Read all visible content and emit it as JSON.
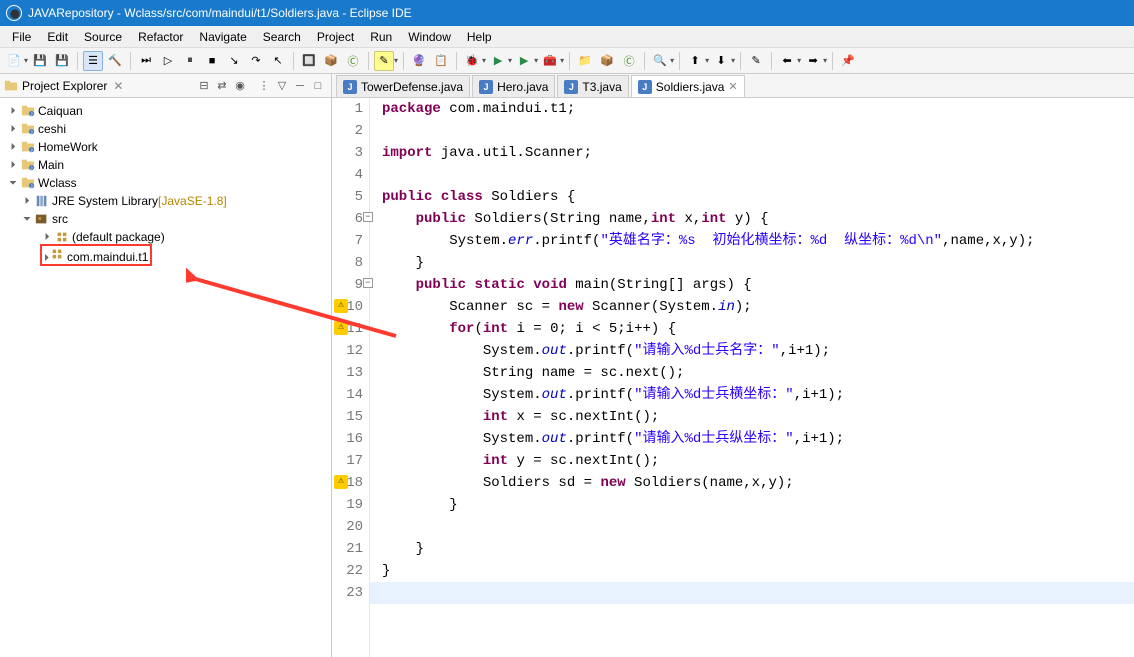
{
  "window": {
    "title": "JAVARepository - Wclass/src/com/maindui/t1/Soldiers.java - Eclipse IDE"
  },
  "menu": [
    "File",
    "Edit",
    "Source",
    "Refactor",
    "Navigate",
    "Search",
    "Project",
    "Run",
    "Window",
    "Help"
  ],
  "explorer": {
    "title": "Project Explorer",
    "projects": [
      {
        "name": "Caiquan",
        "expanded": false
      },
      {
        "name": "ceshi",
        "expanded": false
      },
      {
        "name": "HomeWork",
        "expanded": false
      },
      {
        "name": "Main",
        "expanded": false
      },
      {
        "name": "Wclass",
        "expanded": true,
        "children": [
          {
            "name": "JRE System Library",
            "hint": "[JavaSE-1.8]",
            "type": "lib",
            "expanded": false
          },
          {
            "name": "src",
            "type": "src",
            "expanded": true,
            "children": [
              {
                "name": "(default package)",
                "type": "pkg",
                "expanded": false
              },
              {
                "name": "com.maindui.t1",
                "type": "pkg",
                "expanded": false,
                "highlighted": true
              }
            ]
          }
        ]
      }
    ]
  },
  "tabs": [
    {
      "label": "TowerDefense.java",
      "active": false
    },
    {
      "label": "Hero.java",
      "active": false
    },
    {
      "label": "T3.java",
      "active": false
    },
    {
      "label": "Soldiers.java",
      "active": true
    }
  ],
  "code_lines": [
    {
      "n": 1,
      "tokens": [
        [
          "kw",
          "package"
        ],
        [
          "",
          " com.maindui.t1;"
        ]
      ]
    },
    {
      "n": 2,
      "tokens": []
    },
    {
      "n": 3,
      "tokens": [
        [
          "kw",
          "import"
        ],
        [
          "",
          " java.util.Scanner;"
        ]
      ]
    },
    {
      "n": 4,
      "tokens": []
    },
    {
      "n": 5,
      "tokens": [
        [
          "kw",
          "public"
        ],
        [
          "",
          " "
        ],
        [
          "kw",
          "class"
        ],
        [
          "",
          " Soldiers {"
        ]
      ]
    },
    {
      "n": 6,
      "fold": true,
      "tokens": [
        [
          "",
          "    "
        ],
        [
          "kw",
          "public"
        ],
        [
          "",
          " Soldiers(String name,"
        ],
        [
          "kw",
          "int"
        ],
        [
          "",
          " x,"
        ],
        [
          "kw",
          "int"
        ],
        [
          "",
          " y) {"
        ]
      ]
    },
    {
      "n": 7,
      "tokens": [
        [
          "",
          "        System."
        ],
        [
          "field",
          "err"
        ],
        [
          "",
          ".printf("
        ],
        [
          "str",
          "\"英雄名字：%s  初始化横坐标：%d  纵坐标：%d\\n\""
        ],
        [
          "",
          ",name,x,y);"
        ]
      ]
    },
    {
      "n": 8,
      "tokens": [
        [
          "",
          "    }"
        ]
      ]
    },
    {
      "n": 9,
      "fold": true,
      "tokens": [
        [
          "",
          "    "
        ],
        [
          "kw",
          "public"
        ],
        [
          "",
          " "
        ],
        [
          "kw",
          "static"
        ],
        [
          "",
          " "
        ],
        [
          "kw",
          "void"
        ],
        [
          "",
          " main(String[] args) {"
        ]
      ]
    },
    {
      "n": 10,
      "warn": true,
      "tokens": [
        [
          "",
          "        Scanner sc = "
        ],
        [
          "kw",
          "new"
        ],
        [
          "",
          " Scanner(System."
        ],
        [
          "field",
          "in"
        ],
        [
          "",
          ");"
        ]
      ]
    },
    {
      "n": 11,
      "warn": true,
      "tokens": [
        [
          "",
          "        "
        ],
        [
          "kw",
          "for"
        ],
        [
          "",
          "("
        ],
        [
          "kw",
          "int"
        ],
        [
          "",
          " i = 0; i < 5;i++) {"
        ]
      ]
    },
    {
      "n": 12,
      "tokens": [
        [
          "",
          "            System."
        ],
        [
          "field",
          "out"
        ],
        [
          "",
          ".printf("
        ],
        [
          "str",
          "\"请输入%d士兵名字：\""
        ],
        [
          "",
          ",i+1);"
        ]
      ]
    },
    {
      "n": 13,
      "tokens": [
        [
          "",
          "            String name = sc.next();"
        ]
      ]
    },
    {
      "n": 14,
      "tokens": [
        [
          "",
          "            System."
        ],
        [
          "field",
          "out"
        ],
        [
          "",
          ".printf("
        ],
        [
          "str",
          "\"请输入%d士兵横坐标：\""
        ],
        [
          "",
          ",i+1);"
        ]
      ]
    },
    {
      "n": 15,
      "tokens": [
        [
          "",
          "            "
        ],
        [
          "kw",
          "int"
        ],
        [
          "",
          " x = sc.nextInt();"
        ]
      ]
    },
    {
      "n": 16,
      "tokens": [
        [
          "",
          "            System."
        ],
        [
          "field",
          "out"
        ],
        [
          "",
          ".printf("
        ],
        [
          "str",
          "\"请输入%d士兵纵坐标：\""
        ],
        [
          "",
          ",i+1);"
        ]
      ]
    },
    {
      "n": 17,
      "tokens": [
        [
          "",
          "            "
        ],
        [
          "kw",
          "int"
        ],
        [
          "",
          " y = sc.nextInt();"
        ]
      ]
    },
    {
      "n": 18,
      "warn": true,
      "tokens": [
        [
          "",
          "            Soldiers sd = "
        ],
        [
          "kw",
          "new"
        ],
        [
          "",
          " Soldiers(name,x,y);"
        ]
      ]
    },
    {
      "n": 19,
      "tokens": [
        [
          "",
          "        }"
        ]
      ]
    },
    {
      "n": 20,
      "tokens": []
    },
    {
      "n": 21,
      "tokens": [
        [
          "",
          "    }"
        ]
      ]
    },
    {
      "n": 22,
      "tokens": [
        [
          "",
          "}"
        ]
      ]
    },
    {
      "n": 23,
      "highlight": true,
      "tokens": []
    }
  ]
}
